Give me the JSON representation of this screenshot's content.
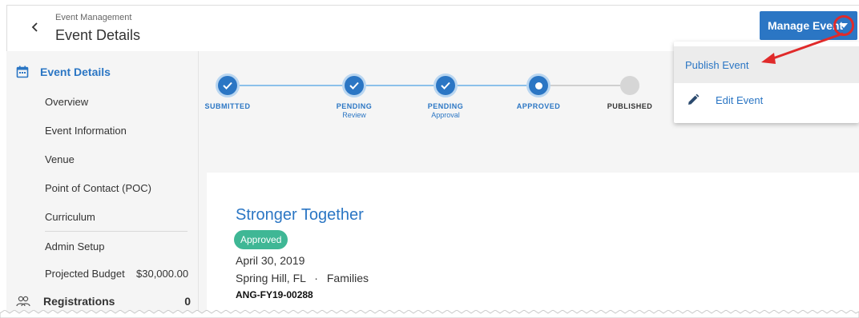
{
  "header": {
    "breadcrumb": "Event Management",
    "title": "Event Details",
    "manage_button_label": "Manage Event"
  },
  "dropdown": {
    "items": [
      {
        "label": "Publish Event",
        "icon": "none"
      },
      {
        "label": "Edit Event",
        "icon": "pencil-icon"
      }
    ]
  },
  "sidebar": {
    "header_label": "Event Details",
    "items": [
      {
        "label": "Overview"
      },
      {
        "label": "Event Information"
      },
      {
        "label": "Venue"
      },
      {
        "label": "Point of Contact (POC)"
      },
      {
        "label": "Curriculum"
      },
      {
        "label": "Admin Setup"
      },
      {
        "label": "Projected Budget"
      }
    ],
    "budget_value": "$30,000.00",
    "registrations_label": "Registrations",
    "registrations_count": "0"
  },
  "stepper": {
    "steps": [
      {
        "label": "SUBMITTED",
        "sub": "",
        "state": "complete"
      },
      {
        "label": "PENDING",
        "sub": "Review",
        "state": "complete"
      },
      {
        "label": "PENDING",
        "sub": "Approval",
        "state": "complete"
      },
      {
        "label": "APPROVED",
        "sub": "",
        "state": "current"
      },
      {
        "label": "PUBLISHED",
        "sub": "",
        "state": "upcoming"
      }
    ]
  },
  "event": {
    "name": "Stronger Together",
    "status": "Approved",
    "date": "April 30, 2019",
    "location": "Spring Hill, FL",
    "separator": "·",
    "audience": "Families",
    "id": "ANG-FY19-00288"
  },
  "colors": {
    "accent": "#2b76c4",
    "approved_badge": "#3fb795",
    "highlight_ring": "#e02a2a"
  }
}
